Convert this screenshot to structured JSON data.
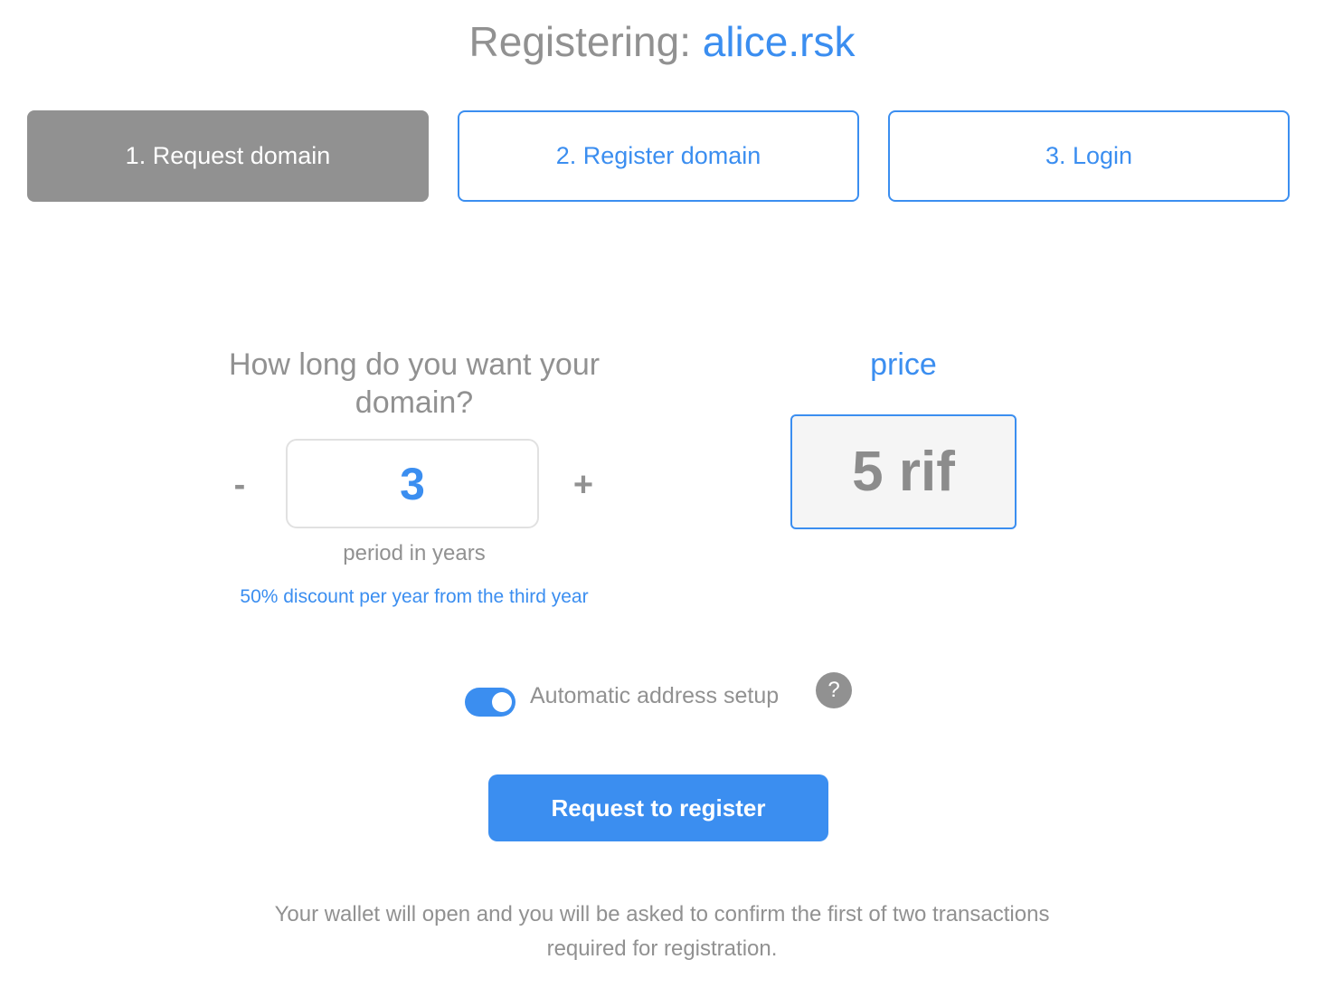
{
  "header": {
    "prefix": "Registering: ",
    "domain": "alice.rsk"
  },
  "steps": [
    {
      "label": "1. Request domain",
      "state": "active"
    },
    {
      "label": "2. Register domain",
      "state": "pending"
    },
    {
      "label": "3. Login",
      "state": "pending"
    }
  ],
  "period": {
    "question": "How long do you want your domain?",
    "minus_label": "-",
    "plus_label": "+",
    "value": "3",
    "unit_label": "period in years",
    "discount_note": "50% discount per year from the third year"
  },
  "price": {
    "label": "price",
    "value": "5 rif"
  },
  "auto_address": {
    "label": "Automatic address setup",
    "enabled": true,
    "help_icon": "?"
  },
  "actions": {
    "submit_label": "Request to register"
  },
  "footer": {
    "note_line1": "Your wallet will open and you will be asked to confirm the first of two transactions",
    "note_line2": "required for registration."
  },
  "colors": {
    "accent": "#3b8ef0",
    "muted": "#919191",
    "price_bg": "#f5f5f5"
  }
}
